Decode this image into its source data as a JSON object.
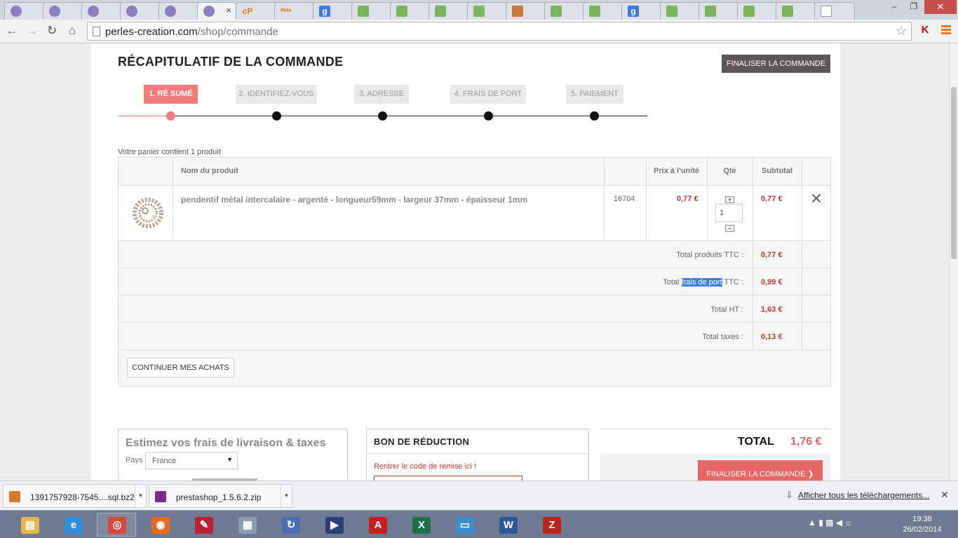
{
  "browser": {
    "url_host": "perles-creation.com",
    "url_path": "/shop/commande",
    "tabs": [
      {
        "icon": "prestashop-icon",
        "active": false
      },
      {
        "icon": "prestashop-icon",
        "active": false
      },
      {
        "icon": "prestashop-icon",
        "active": false
      },
      {
        "icon": "prestashop-icon",
        "active": false
      },
      {
        "icon": "prestashop-icon",
        "active": false
      },
      {
        "icon": "prestashop-icon",
        "active": true
      },
      {
        "icon": "cpanel-icon",
        "active": false,
        "label": "cP"
      },
      {
        "icon": "phpmyadmin-icon",
        "active": false,
        "label": "PMA"
      },
      {
        "icon": "google-icon",
        "active": false,
        "label": "g"
      },
      {
        "icon": "shopify-bag-icon",
        "active": false
      },
      {
        "icon": "shopify-bag-icon",
        "active": false
      },
      {
        "icon": "shopify-bag-icon",
        "active": false
      },
      {
        "icon": "shopify-bag-icon",
        "active": false
      },
      {
        "icon": "folder-icon",
        "active": false
      },
      {
        "icon": "shopify-bag-icon",
        "active": false
      },
      {
        "icon": "shopify-bag-icon",
        "active": false
      },
      {
        "icon": "google-icon",
        "active": false,
        "label": "g"
      },
      {
        "icon": "shopify-bag-icon",
        "active": false
      },
      {
        "icon": "shopify-bag-icon",
        "active": false
      },
      {
        "icon": "shopify-bag-icon",
        "active": false
      },
      {
        "icon": "shopify-bag-icon",
        "active": false
      },
      {
        "icon": "blank-page-icon",
        "active": false
      }
    ],
    "close_tab_glyph": "×",
    "window": {
      "minimize": "–",
      "maximize": "❐",
      "close": "✕"
    }
  },
  "page": {
    "title": "RÉCAPITULATIF DE LA COMMANDE",
    "finalize_top": "FINALISER LA COMMANDE",
    "steps": [
      "1. RÉ SUMÉ",
      "2. IDENTIFIEZ-VOUS",
      "3. ADRESSE",
      "4. FRAIS DE PORT",
      "5. PAIEMENT"
    ],
    "cart_count": "Votre panier contient 1 produit",
    "columns": {
      "name": "Nom du produit",
      "unit_price": "Prix à l'unité",
      "qty": "Qté",
      "subtotal": "Subtotal"
    },
    "product": {
      "name": "pendentif métal intercalaire - argenté - longueur59mm - largeur 37mm - épaisseur 1mm",
      "reference": "16704",
      "unit_price": "0,77 €",
      "quantity": "1",
      "subtotal": "0,77 €",
      "qty_plus": "+",
      "qty_minus": "−"
    },
    "totals": {
      "products_label": "Total produits TTC :",
      "products_value": "0,77 €",
      "shipping_label_pre": "Total ",
      "shipping_label_highlight": "frais de port",
      "shipping_label_post": " TTC :",
      "shipping_value": "0,99 €",
      "ht_label": "Total HT :",
      "ht_value": "1,63 €",
      "taxes_label": "Total taxes :",
      "taxes_value": "0,13 €"
    },
    "continue_button": "CONTINUER MES ACHATS",
    "estimate": {
      "title": "Estimez vos frais de livraison & taxes",
      "country_label": "Pays",
      "country_value": "France"
    },
    "voucher": {
      "title": "BON DE RÉDUCTION",
      "hint": "Rentrer le code de remise ici !"
    },
    "total": {
      "label": "TOTAL",
      "value": "1,76 €",
      "finalize": "FINALISER LA COMMANDE"
    }
  },
  "downloads": {
    "items": [
      "1391757928-7545....sql.bz2",
      "prestashop_1.5.6.2.zip"
    ],
    "show_all": "Afficher tous les téléchargements..."
  },
  "taskbar": {
    "apps": [
      {
        "icon": "file-explorer-icon",
        "color": "#e6b84a"
      },
      {
        "icon": "internet-explorer-icon",
        "color": "#2f8fd8"
      },
      {
        "icon": "chrome-icon",
        "color": "#d9473b",
        "running": true
      },
      {
        "icon": "firefox-icon",
        "color": "#e66b1f"
      },
      {
        "icon": "notepad-icon",
        "color": "#b8232f"
      },
      {
        "icon": "calculator-icon",
        "color": "#8a9bb5"
      },
      {
        "icon": "sync-icon",
        "color": "#4a6fb5"
      },
      {
        "icon": "media-player-icon",
        "color": "#2a3f7a"
      },
      {
        "icon": "acrobat-icon",
        "color": "#c81d1d"
      },
      {
        "icon": "excel-icon",
        "color": "#1e7145"
      },
      {
        "icon": "photo-viewer-icon",
        "color": "#3a8fc8"
      },
      {
        "icon": "word-icon",
        "color": "#2b579a"
      },
      {
        "icon": "filezilla-icon",
        "color": "#b8241c"
      }
    ],
    "time": "19:38",
    "date": "26/02/2014"
  }
}
